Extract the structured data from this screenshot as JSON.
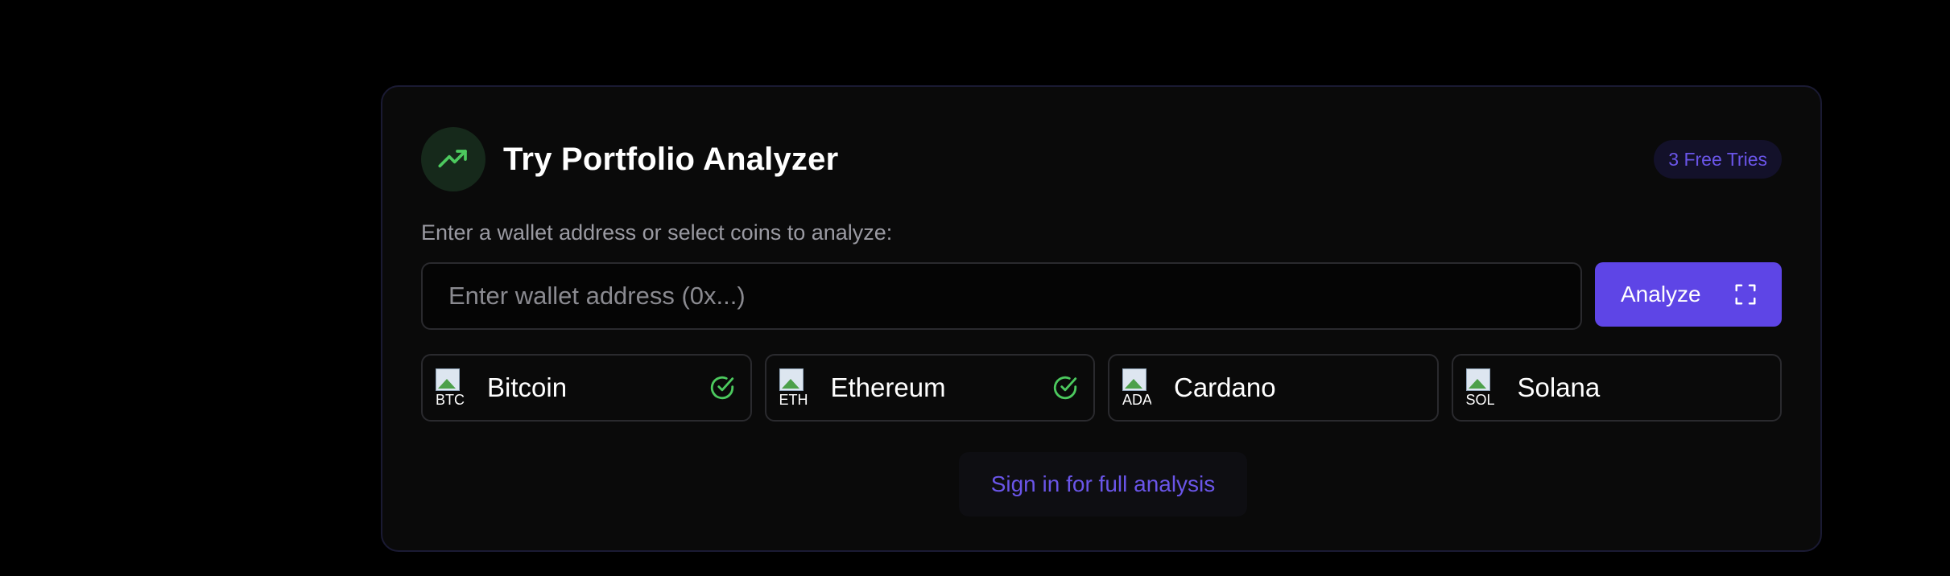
{
  "card": {
    "title": "Try Portfolio Analyzer",
    "badge": "3 Free Tries",
    "icon": "trending-up-icon",
    "prompt": "Enter a wallet address or select coins to analyze:"
  },
  "wallet": {
    "placeholder": "Enter wallet address (0x...)",
    "value": ""
  },
  "analyze_button": {
    "label": "Analyze",
    "icon": "expand-icon"
  },
  "coins": [
    {
      "name": "Bitcoin",
      "alt": "BTC",
      "selected": true
    },
    {
      "name": "Ethereum",
      "alt": "ETH",
      "selected": true
    },
    {
      "name": "Cardano",
      "alt": "ADA",
      "selected": false
    },
    {
      "name": "Solana",
      "alt": "SOL",
      "selected": false
    }
  ],
  "signin": {
    "label": "Sign in for full analysis"
  },
  "colors": {
    "accent": "#5e45e6",
    "accent_text": "#6a55e8",
    "success": "#4cc95e",
    "background": "#000000",
    "card": "#0a0a0a"
  }
}
